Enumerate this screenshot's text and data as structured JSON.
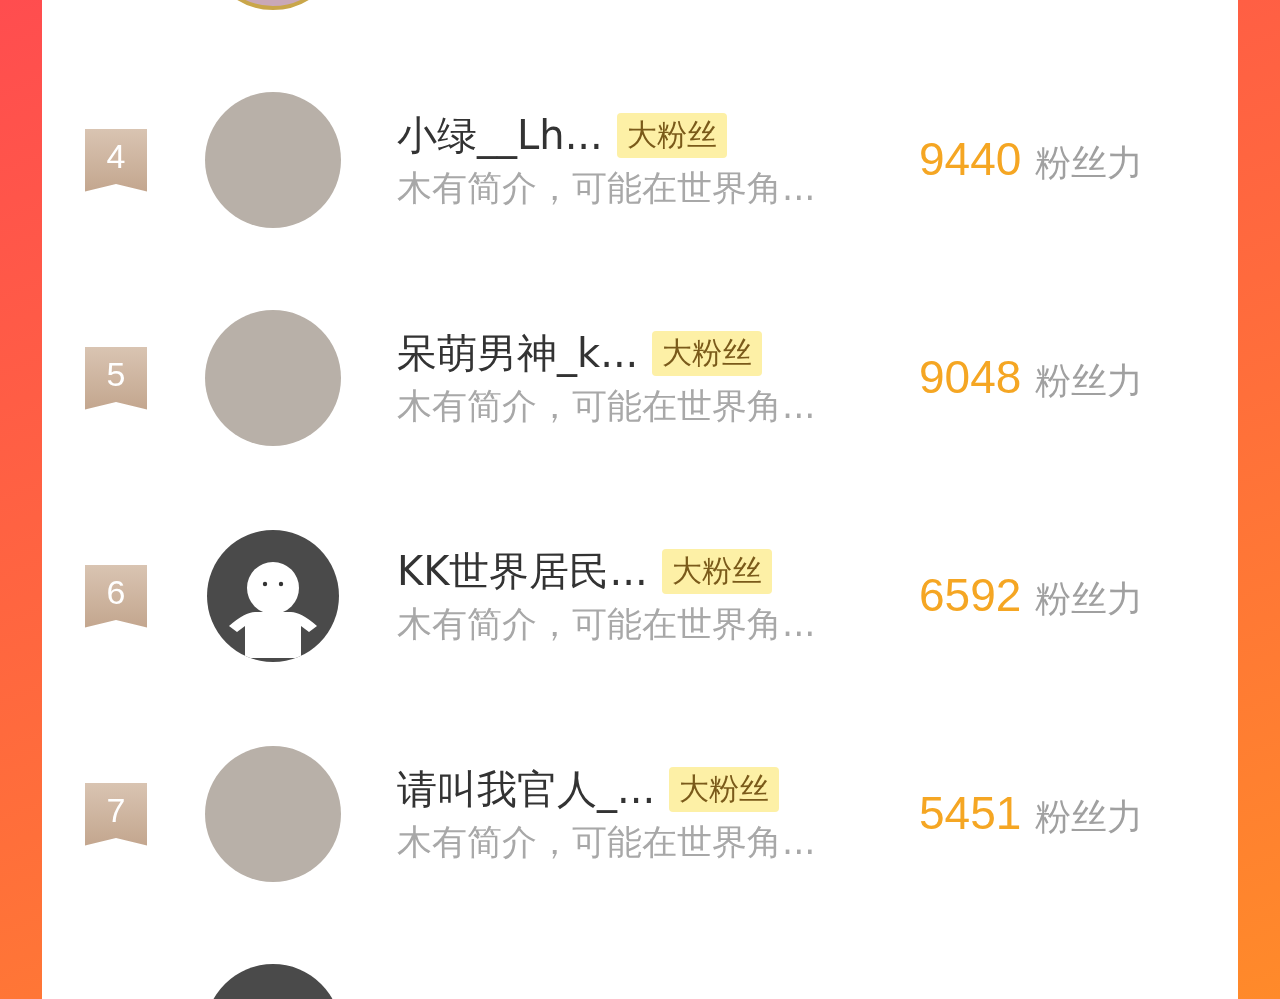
{
  "ranking": [
    {
      "kind": "cut_top",
      "avatar": {
        "kind": "photo"
      }
    },
    {
      "kind": "full",
      "rank": "4",
      "avatar": {
        "kind": "photo"
      },
      "name": "小绿__Lh...",
      "badge": "大粉丝",
      "intro": "木有简介，可能在世界角...",
      "score": "9440",
      "score_unit": "粉丝力"
    },
    {
      "kind": "full",
      "rank": "5",
      "avatar": {
        "kind": "photo"
      },
      "name": "呆萌男神_k...",
      "badge": "大粉丝",
      "intro": "木有简介，可能在世界角...",
      "score": "9048",
      "score_unit": "粉丝力"
    },
    {
      "kind": "full",
      "rank": "6",
      "avatar": {
        "kind": "default"
      },
      "name": "KK世界居民...",
      "badge": "大粉丝",
      "intro": "木有简介，可能在世界角...",
      "score": "6592",
      "score_unit": "粉丝力"
    },
    {
      "kind": "full",
      "rank": "7",
      "avatar": {
        "kind": "photo"
      },
      "name": "请叫我官人_...",
      "badge": "大粉丝",
      "intro": "木有简介，可能在世界角...",
      "score": "5451",
      "score_unit": "粉丝力"
    },
    {
      "kind": "cut_bottom",
      "avatar": {
        "kind": "default"
      }
    }
  ]
}
